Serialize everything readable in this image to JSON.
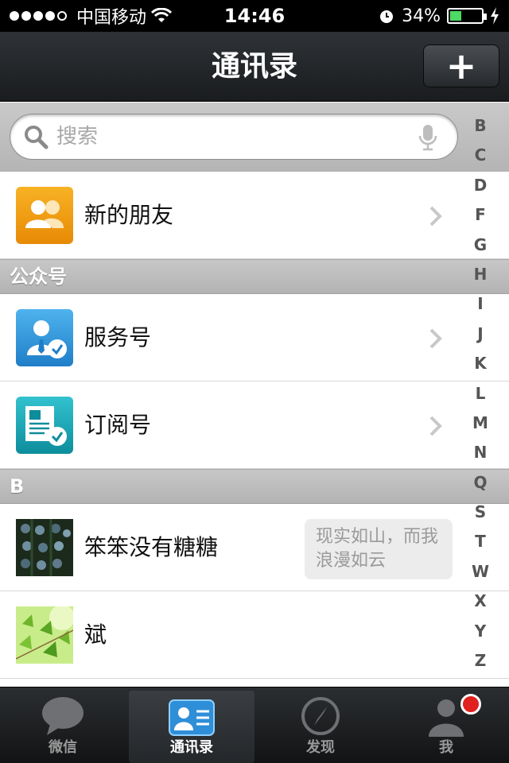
{
  "status_bar": {
    "carrier": "中国移动",
    "time": "14:46",
    "battery": "34%"
  },
  "nav": {
    "title": "通讯录",
    "add_label": "+"
  },
  "search": {
    "placeholder": "搜索"
  },
  "rows": {
    "new_friends": "新的朋友",
    "service": "服务号",
    "subscription": "订阅号",
    "contact1": "笨笨没有糖糖",
    "contact1_signature": "现实如山，而我浪漫如云",
    "contact2": "斌"
  },
  "sections": {
    "public": "公众号",
    "b": "B"
  },
  "index_letters": [
    "B",
    "C",
    "D",
    "F",
    "G",
    "H",
    "I",
    "J",
    "K",
    "L",
    "M",
    "N",
    "Q",
    "S",
    "T",
    "W",
    "X",
    "Y",
    "Z"
  ],
  "tabs": [
    {
      "label": "微信"
    },
    {
      "label": "通讯录"
    },
    {
      "label": "发现"
    },
    {
      "label": "我"
    }
  ],
  "colors": {
    "accent_blue": "#3aa0e0",
    "orange": "#f09a10",
    "teal": "#1aa6b6",
    "badge_red": "#e0211f"
  }
}
